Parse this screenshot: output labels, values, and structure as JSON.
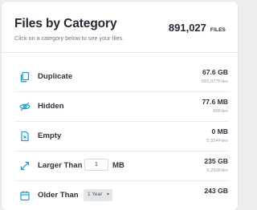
{
  "header": {
    "title": "Files by Category",
    "subtitle": "Click on a category below to see your files.",
    "total_count": "891,027",
    "total_unit": "FILES"
  },
  "categories": [
    {
      "label": "Duplicate",
      "size": "67.6 GB",
      "files": "581,977Files",
      "icon": "duplicate-icon"
    },
    {
      "label": "Hidden",
      "size": "77.6 MB",
      "files": "69Files",
      "icon": "eye-slash-icon"
    },
    {
      "label": "Empty",
      "size": "0 MB",
      "files": "5,554Files",
      "icon": "empty-file-icon"
    },
    {
      "label": "Larger Than",
      "input_value": "1",
      "unit": "MB",
      "size": "235 GB",
      "files": "9,290Files",
      "icon": "expand-arrows-icon"
    },
    {
      "label": "Older Than",
      "select_value": "1 Year",
      "size": "243 GB",
      "icon": "calendar-icon"
    }
  ],
  "colors": {
    "accent": "#1f9bd1",
    "background": "#eceef0"
  }
}
